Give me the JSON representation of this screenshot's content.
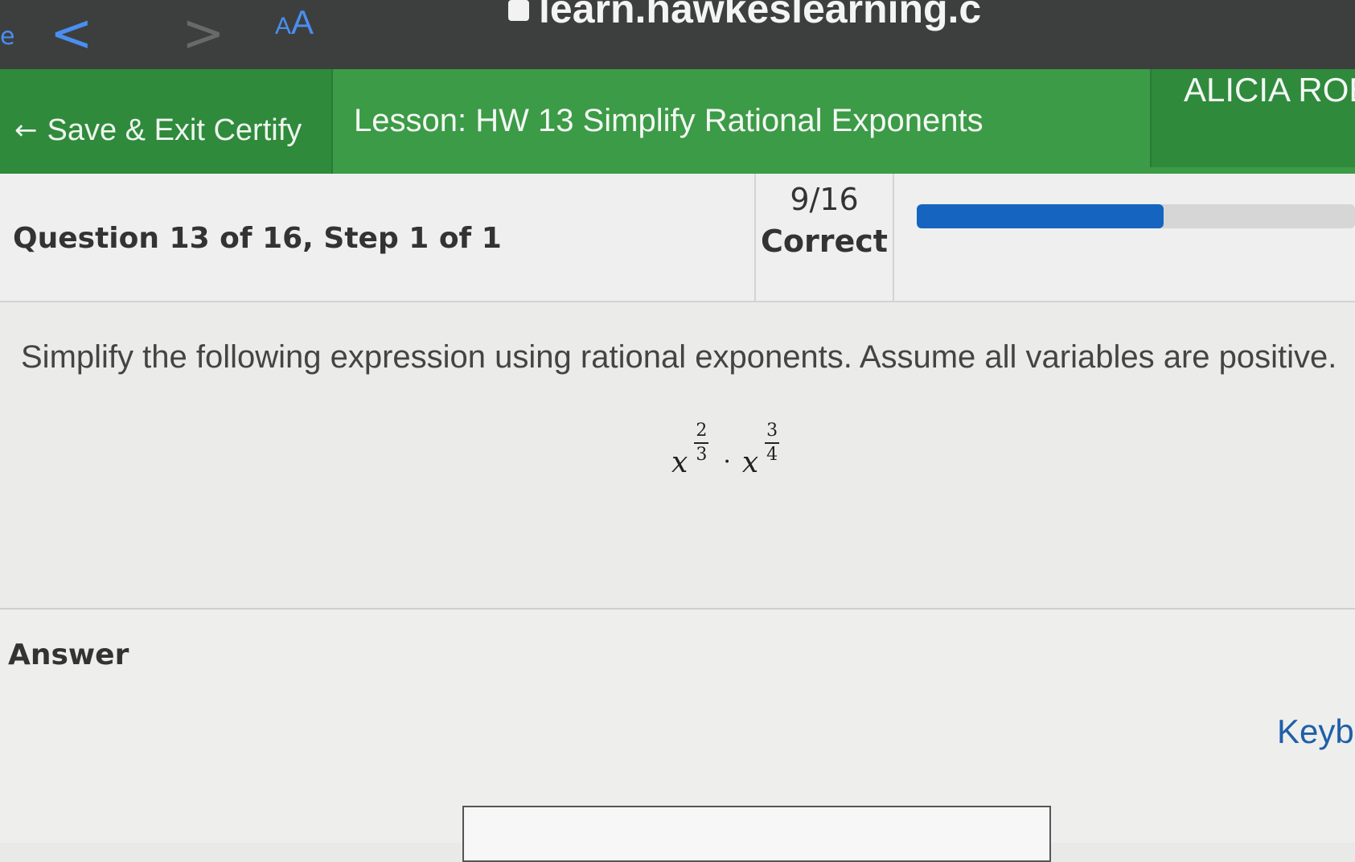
{
  "browser": {
    "edge_glyph": "e",
    "back_glyph": "<",
    "forward_glyph": ">",
    "text_size_small": "A",
    "text_size_large": "A",
    "url": "learn.hawkeslearning.c"
  },
  "header": {
    "save_exit_label": "Save & Exit Certify",
    "lesson_title": "Lesson: HW 13 Simplify Rational Exponents",
    "user_name": "ALICIA ROE"
  },
  "status": {
    "question_label": "Question 13 of 16, Step 1 of 1",
    "score_fraction": "9/16",
    "score_label": "Correct",
    "progress": 0.5625,
    "progress_color": "#1565c0"
  },
  "problem": {
    "prompt": "Simplify the following expression using rational exponents. Assume all variables are positive.",
    "terms": [
      {
        "base": "x",
        "num": "2",
        "den": "3"
      },
      {
        "base": "x",
        "num": "3",
        "den": "4"
      }
    ],
    "operator": "·"
  },
  "answer": {
    "label": "Answer",
    "keyboard_link": "Keyboard"
  },
  "colors": {
    "header_green": "#3c9b46",
    "header_dark_green": "#2f8a3c",
    "browser_accent": "#4a8ef0"
  }
}
